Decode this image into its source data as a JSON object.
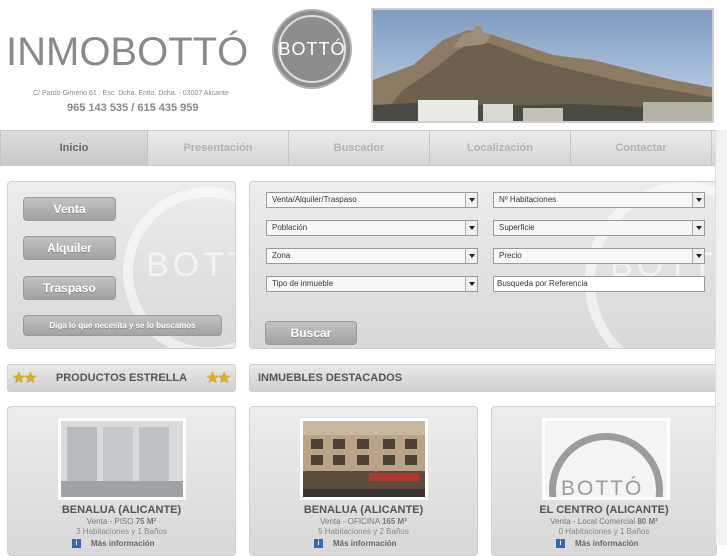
{
  "header": {
    "brand": "INMOBOTTÓ",
    "logo_text": "BOTTÓ",
    "address": "C/ Pardo Gimeno 61 . Esc. Dcha. Entlo. Dcha. - 03007 Alicante",
    "phones": "965 143 535 / 615 435 959"
  },
  "nav": {
    "items": [
      {
        "label": "Inicio"
      },
      {
        "label": "Presentación"
      },
      {
        "label": "Buscador"
      },
      {
        "label": "Localización"
      },
      {
        "label": "Contactar"
      }
    ]
  },
  "left_panel": {
    "venta": "Venta",
    "alquiler": "Alquiler",
    "traspaso": "Traspaso",
    "request": "Diga lo que necesita y se lo buscamos",
    "watermark": "BOTT"
  },
  "search": {
    "operation": "Venta/Alquiler/Traspaso",
    "poblacion": "Población",
    "zona": "Zona",
    "tipo": "Tipo de inmueble",
    "habitaciones": "Nº Habitaciones",
    "superficie": "Superficie",
    "precio": "Precio",
    "referencia": "Busqueda por Referencia",
    "submit": "Buscar",
    "watermark": "BOTT"
  },
  "sections": {
    "estrella": "PRODUCTOS ESTRELLA",
    "destacados": "INMUEBLES DESTACADOS"
  },
  "cards": [
    {
      "title": "BENALUA (ALICANTE)",
      "type": "Venta - PISO",
      "size": "75 M²",
      "rooms": "3 Habitaciones y 1 Baños",
      "more": "Más información"
    },
    {
      "title": "BENALUA (ALICANTE)",
      "type": "Venta - OFICINA",
      "size": "165 M²",
      "rooms": "5 Habitaciones y 2 Baños",
      "more": "Más información"
    },
    {
      "title": "EL CENTRO (ALICANTE)",
      "type": "Venta - Local Comercial",
      "size": "80 M²",
      "rooms": "0 Habitaciones y 1 Baños",
      "more": "Más información",
      "thumb_text": "BOTTÓ"
    }
  ],
  "colors": {
    "star": "#d6b21b",
    "info_icon": "#3a64b0"
  }
}
